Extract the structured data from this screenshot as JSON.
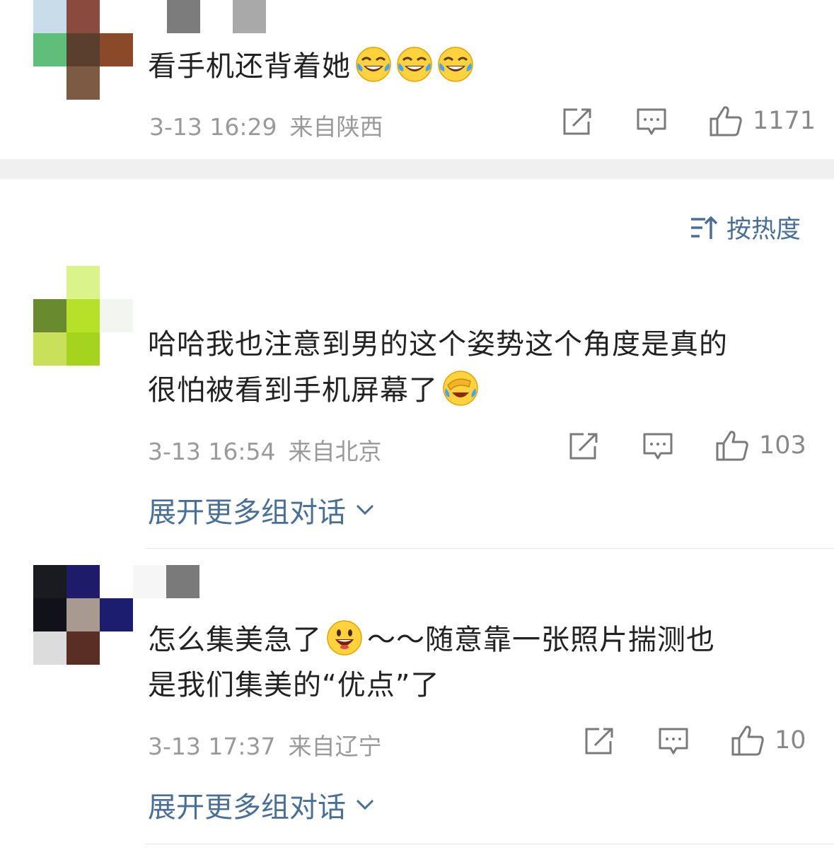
{
  "sort": {
    "label": "按热度"
  },
  "comments": [
    {
      "text": "看手机还背着她",
      "time": "3-13 16:29",
      "source": "来自陕西",
      "likes": "1171",
      "emojis": [
        "laughing-tears-emoji",
        "laughing-tears-emoji",
        "laughing-tears-emoji"
      ]
    },
    {
      "text_line1": "哈哈我也注意到男的这个姿势这个角度是真的",
      "text_line2": "很怕被看到手机屏幕了",
      "time": "3-13 16:54",
      "source": "来自北京",
      "likes": "103",
      "expand_label": "展开更多组对话"
    },
    {
      "text_line1_a": "怎么集美急了",
      "text_line1_b": "～～随意靠一张照片揣测也",
      "text_line2": "是我们集美的“优点”了",
      "time": "3-13 17:37",
      "source": "来自辽宁",
      "likes": "10",
      "expand_label": "展开更多组对话"
    }
  ],
  "colors": {
    "link": "#4a6f97",
    "meta": "#9a9a9a",
    "section_gap": "#f0f0f0"
  }
}
